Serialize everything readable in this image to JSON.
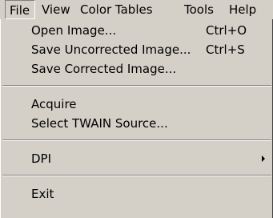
{
  "menubar": {
    "items": [
      {
        "label": "File"
      },
      {
        "label": "View"
      },
      {
        "label": "Color Tables"
      },
      {
        "label": "Tools"
      },
      {
        "label": "Help"
      }
    ]
  },
  "file_menu": {
    "open_image": {
      "label": "Open Image...",
      "shortcut": "Ctrl+O"
    },
    "save_uncorrected": {
      "label": "Save Uncorrected Image...",
      "shortcut": "Ctrl+S"
    },
    "save_corrected": {
      "label": "Save Corrected Image..."
    },
    "acquire": {
      "label": "Acquire"
    },
    "select_twain": {
      "label": "Select TWAIN Source..."
    },
    "dpi": {
      "label": "DPI",
      "has_submenu": true
    },
    "exit": {
      "label": "Exit"
    }
  }
}
